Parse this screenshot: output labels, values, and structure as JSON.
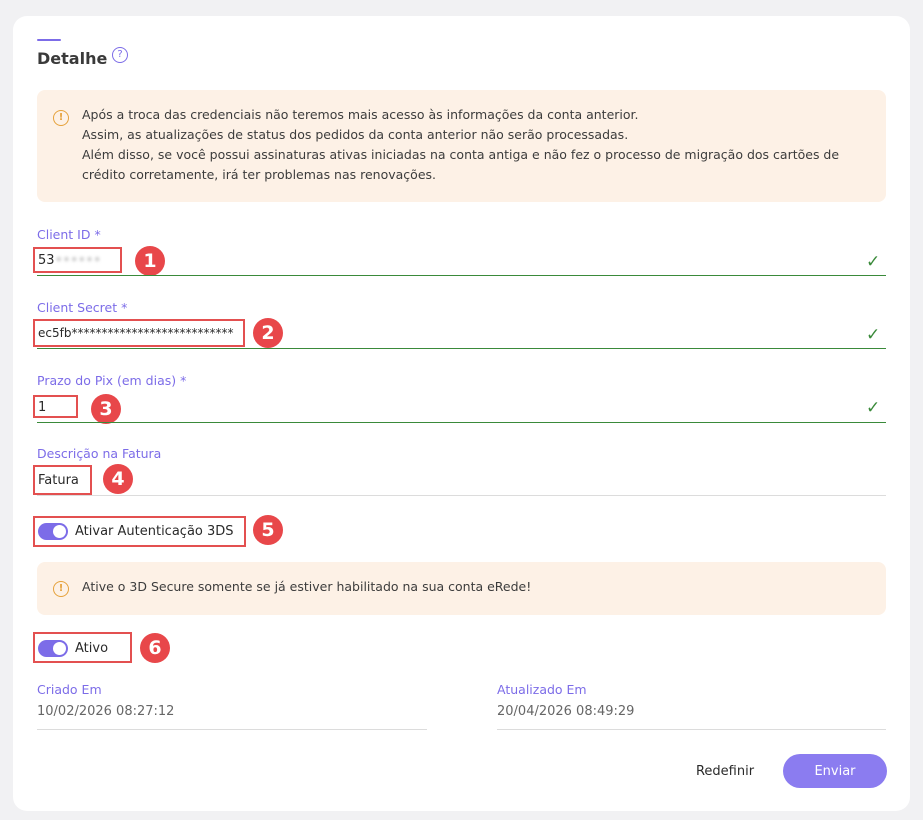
{
  "header": {
    "title": "Detalhe",
    "help_icon": "question-circle-icon"
  },
  "alerts": {
    "credentials_warning": {
      "icon": "warning-circle-icon",
      "lines": [
        "Após a troca das credenciais não teremos mais acesso às informações da conta anterior.",
        "Assim, as atualizações de status dos pedidos da conta anterior não serão processadas.",
        "Além disso, se você possui assinaturas ativas iniciadas na conta antiga e não fez o processo de migração dos cartões de",
        "crédito corretamente, irá ter problemas nas renovações."
      ]
    },
    "secure_warning": {
      "icon": "warning-circle-icon",
      "text": "Ative o 3D Secure somente se já estiver habilitado na sua conta eRede!"
    }
  },
  "form": {
    "client_id": {
      "label": "Client ID *",
      "value": "53",
      "hidden_suffix": "••••••"
    },
    "client_secret": {
      "label": "Client Secret *",
      "value": "ec5fb***************************"
    },
    "pix_term": {
      "label": "Prazo do Pix (em dias) *",
      "value": "1"
    },
    "invoice_description": {
      "label": "Descrição na Fatura",
      "value": "Fatura"
    },
    "toggle_3ds": {
      "label": "Ativar Autenticação 3DS",
      "checked": true
    },
    "toggle_active": {
      "label": "Ativo",
      "checked": true
    }
  },
  "meta": {
    "created": {
      "label": "Criado Em",
      "value": "10/02/2026 08:27:12"
    },
    "updated": {
      "label": "Atualizado Em",
      "value": "20/04/2026 08:49:29"
    }
  },
  "annotations": [
    "1",
    "2",
    "3",
    "4",
    "5",
    "6"
  ],
  "actions": {
    "reset_label": "Redefinir",
    "submit_label": "Enviar"
  },
  "colors": {
    "accent": "#7c6ce8",
    "button": "#8b7cf0",
    "valid_green": "#3a8a3a",
    "alert_bg": "#fdf1e6",
    "alert_icon": "#e6a23c",
    "annotation_red": "#e8474a"
  }
}
